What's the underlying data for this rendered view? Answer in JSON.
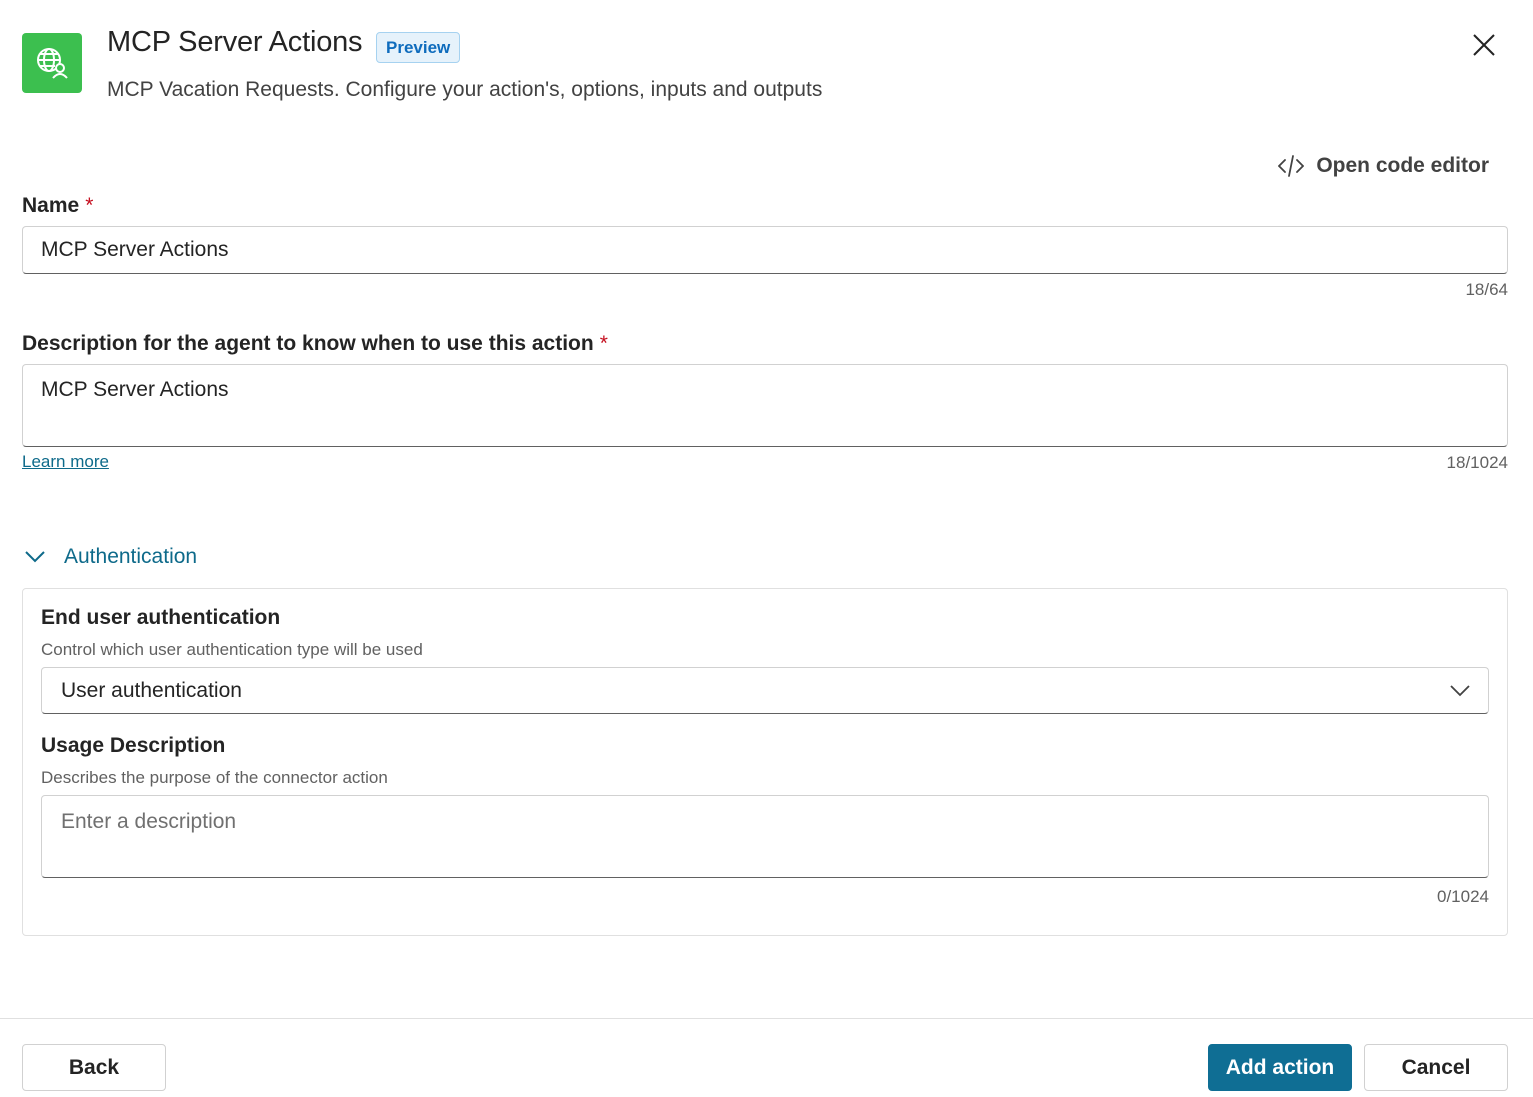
{
  "header": {
    "app_icon": "globe-person-icon",
    "title": "MCP Server Actions",
    "badge": "Preview",
    "subtitle": "MCP Vacation Requests. Configure your action's, options, inputs and outputs",
    "close_icon": "close-icon"
  },
  "toolbar": {
    "code_editor_label": "Open code editor",
    "code_icon": "code-icon"
  },
  "name_field": {
    "label": "Name",
    "required_mark": "*",
    "value": "MCP Server Actions",
    "counter": "18/64"
  },
  "description_field": {
    "label": "Description for the agent to know when to use this action",
    "required_mark": "*",
    "value": "MCP Server Actions",
    "counter": "18/1024",
    "learn_more": "Learn more"
  },
  "authentication": {
    "section_label": "Authentication",
    "expanded": true,
    "end_user_auth": {
      "label": "End user authentication",
      "hint": "Control which user authentication type will be used",
      "selected": "User authentication"
    },
    "usage_description": {
      "label": "Usage Description",
      "hint": "Describes the purpose of the connector action",
      "placeholder": "Enter a description",
      "counter": "0/1024"
    }
  },
  "footer": {
    "back_label": "Back",
    "add_action_label": "Add action",
    "cancel_label": "Cancel"
  },
  "colors": {
    "app_icon_bg": "#3cbf4f",
    "primary": "#0f6e94",
    "link": "#0e6a8a",
    "required": "#c50f1f",
    "badge_bg": "#e6f2fb"
  }
}
